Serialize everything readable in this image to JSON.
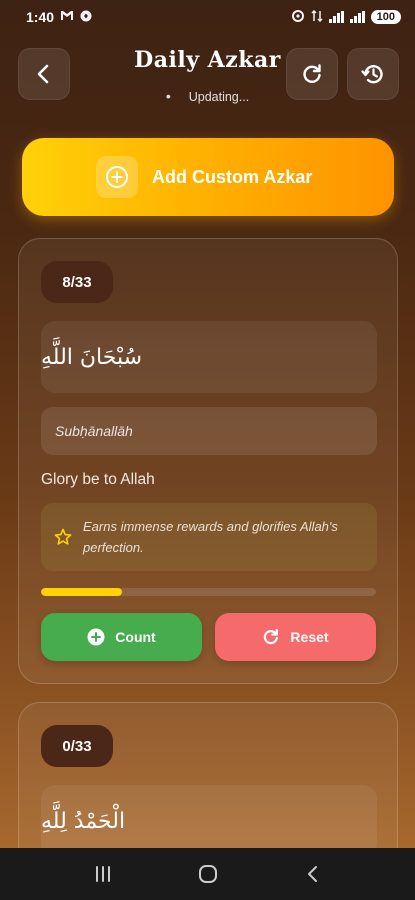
{
  "status_bar": {
    "time": "1:40",
    "battery": "100"
  },
  "header": {
    "title": "Daily Azkar",
    "status": "Updating..."
  },
  "add_button": {
    "label": "Add Custom Azkar"
  },
  "azkar": [
    {
      "counter": "8/33",
      "arabic": "سُبْحَانَ اللَّهِ",
      "transliteration": "Subḥānallāh",
      "translation": "Glory be to Allah",
      "benefit": "Earns immense rewards and glorifies Allah's perfection.",
      "progress": 0.2424,
      "count_label": "Count",
      "reset_label": "Reset"
    },
    {
      "counter": "0/33",
      "arabic": "الْحَمْدُ لِلَّهِ"
    }
  ],
  "colors": {
    "accent_yellow": "#ffd200",
    "count_green": "#46ac4d",
    "reset_red": "#f56a6a",
    "badge_brown": "#4a2716"
  },
  "icons": {
    "back": "arrow-left",
    "refresh": "refresh",
    "history": "history-clock",
    "add": "plus-circle",
    "benefit": "star-outline",
    "count": "plus-circle-filled",
    "reset": "refresh"
  }
}
